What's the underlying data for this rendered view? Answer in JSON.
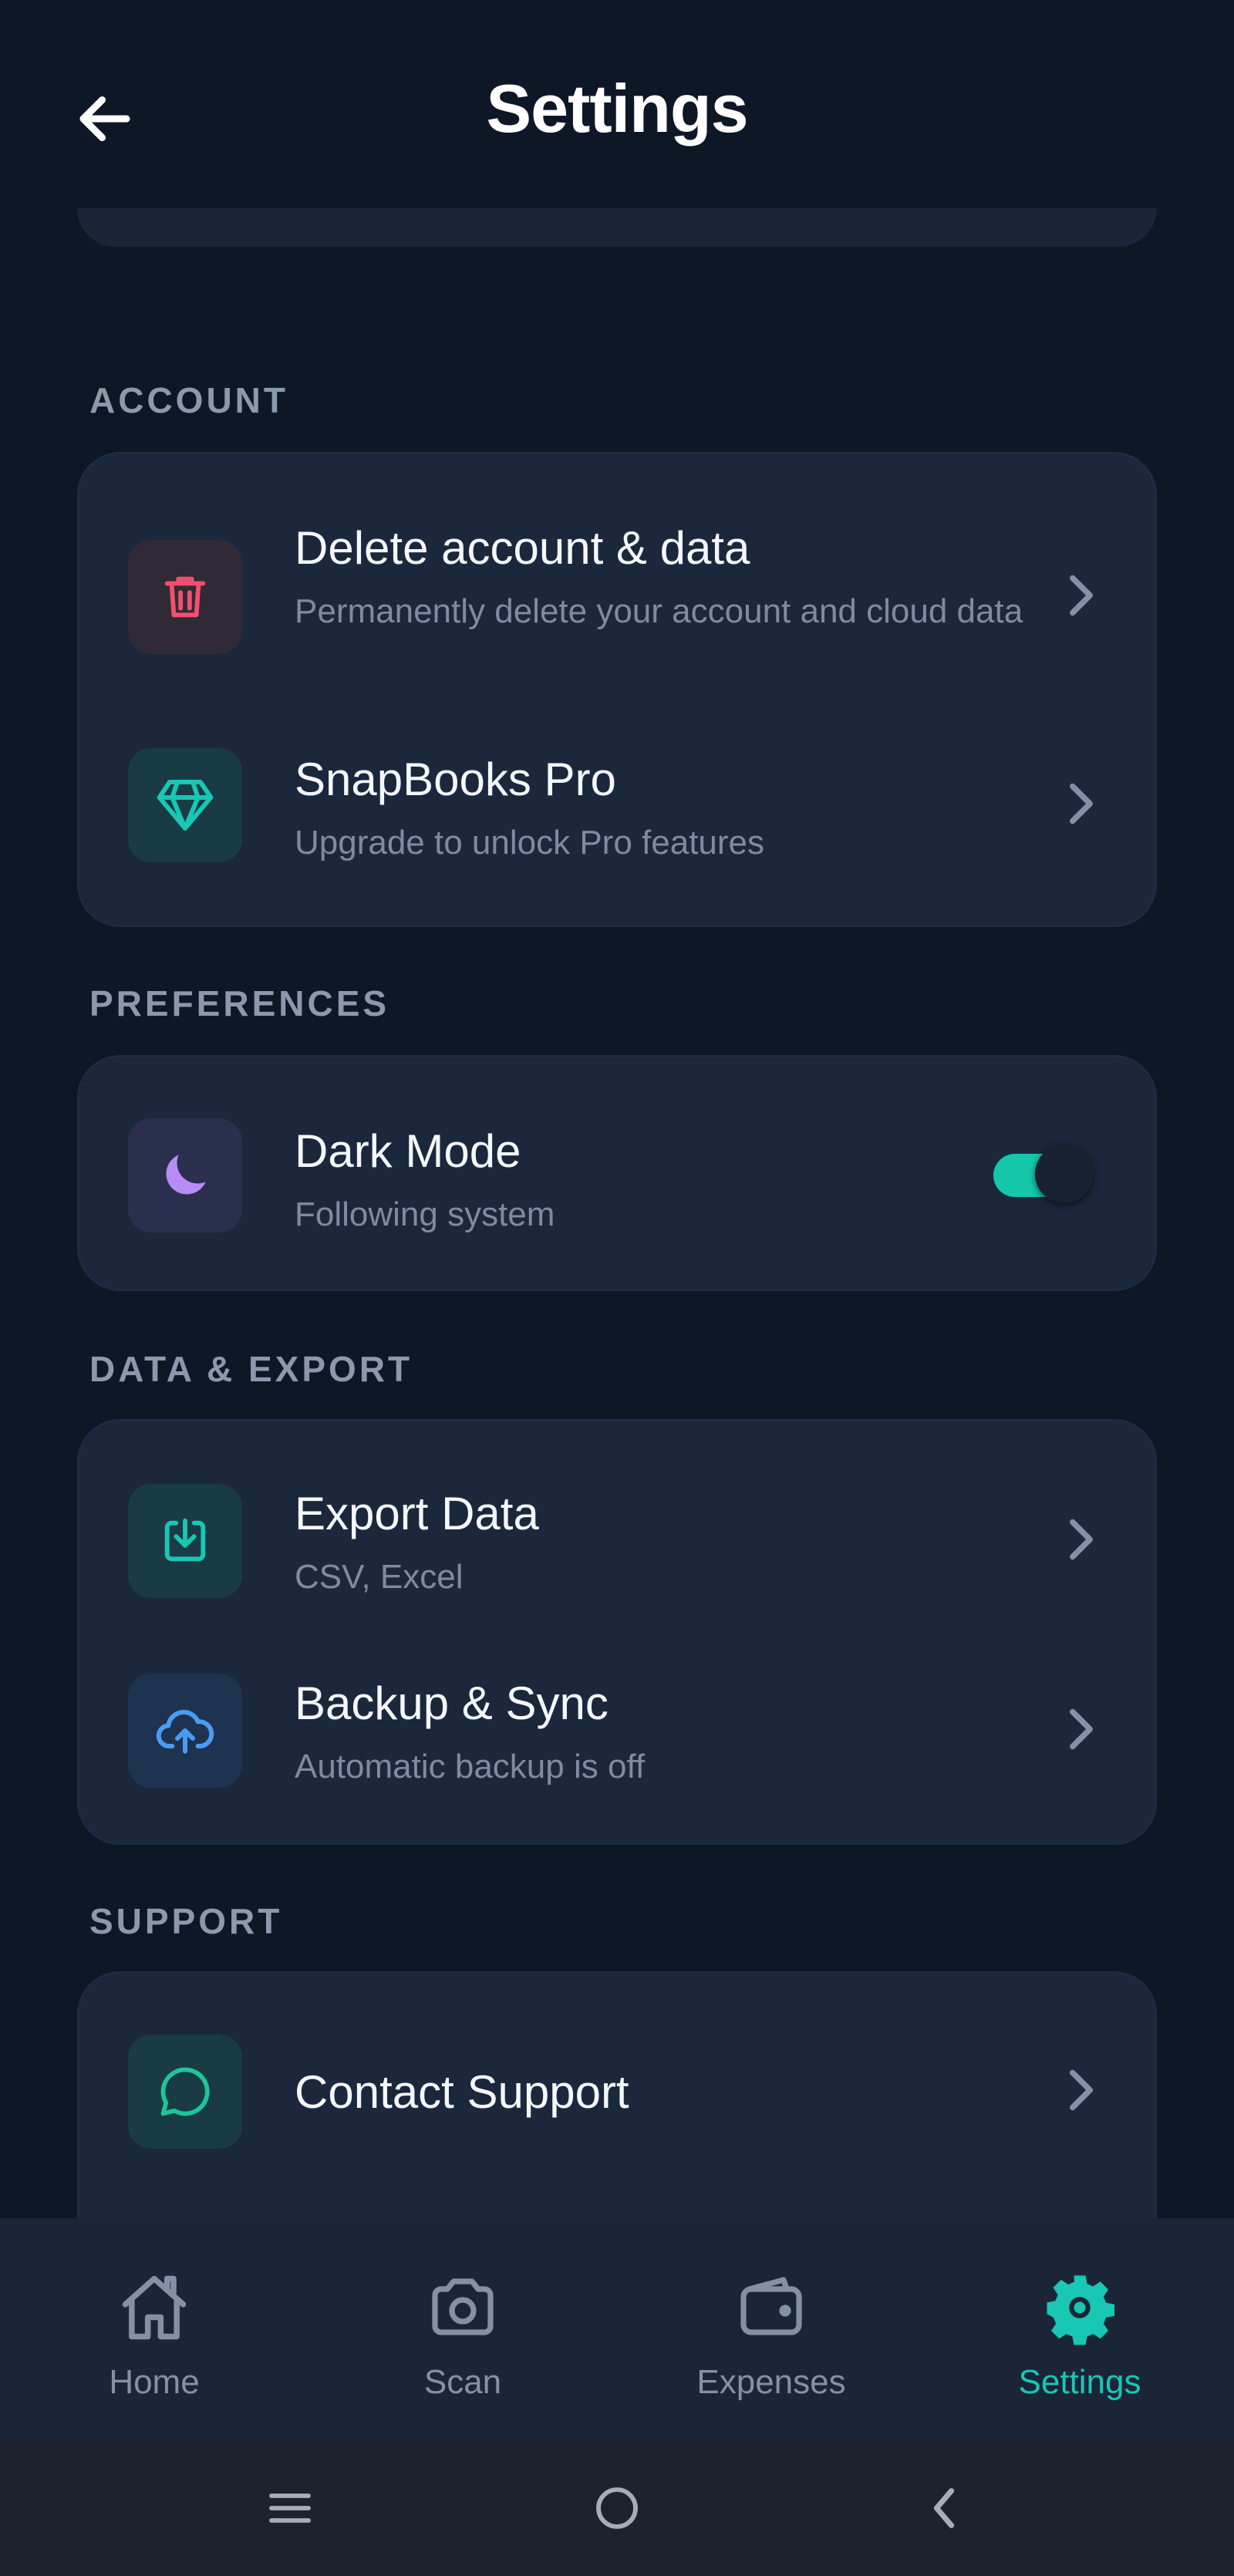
{
  "header": {
    "title": "Settings"
  },
  "sections": {
    "account": {
      "label": "ACCOUNT",
      "items": [
        {
          "title": "Delete account & data",
          "subtitle": "Permanently delete your account and cloud data",
          "icon": "trash-icon",
          "color": "#f0506e"
        },
        {
          "title": "SnapBooks Pro",
          "subtitle": "Upgrade to unlock Pro features",
          "icon": "diamond-icon",
          "color": "#18c7b4"
        }
      ]
    },
    "preferences": {
      "label": "PREFERENCES",
      "items": [
        {
          "title": "Dark Mode",
          "subtitle": "Following system",
          "icon": "moon-icon",
          "color": "#b78cf7",
          "toggle_on": true
        }
      ]
    },
    "data_export": {
      "label": "DATA & EXPORT",
      "items": [
        {
          "title": "Export Data",
          "subtitle": "CSV, Excel",
          "icon": "download-icon",
          "color": "#18c7b4"
        },
        {
          "title": "Backup & Sync",
          "subtitle": "Automatic backup is off",
          "icon": "cloud-upload-icon",
          "color": "#4a9cf0"
        }
      ]
    },
    "support": {
      "label": "SUPPORT",
      "items": [
        {
          "title": "Contact Support",
          "icon": "chat-bubble-icon",
          "color": "#1bc79a"
        }
      ]
    }
  },
  "bottom_nav": {
    "items": [
      {
        "label": "Home",
        "icon": "home-icon",
        "active": false
      },
      {
        "label": "Scan",
        "icon": "camera-icon",
        "active": false
      },
      {
        "label": "Expenses",
        "icon": "wallet-icon",
        "active": false
      },
      {
        "label": "Settings",
        "icon": "gear-icon",
        "active": true
      }
    ]
  },
  "colors": {
    "background": "#0e1726",
    "card": "#1b283b",
    "accent": "#18c7b4",
    "section_label": "#8b99ad"
  }
}
